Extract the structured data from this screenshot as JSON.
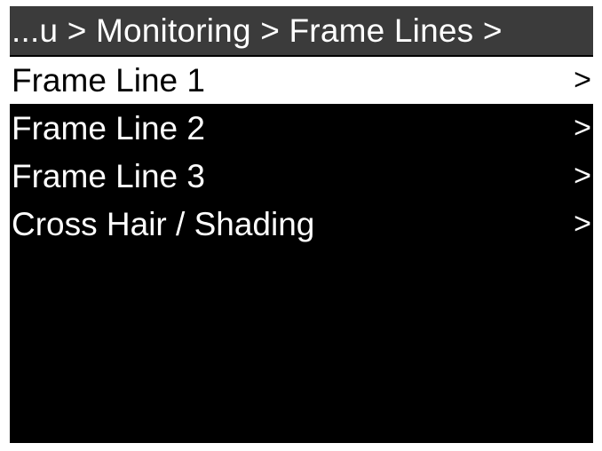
{
  "header": {
    "breadcrumb": "...u > Monitoring > Frame Lines >"
  },
  "menu": {
    "items": [
      {
        "label": "Frame Line 1",
        "chevron": ">",
        "selected": true
      },
      {
        "label": "Frame Line 2",
        "chevron": ">",
        "selected": false
      },
      {
        "label": "Frame Line 3",
        "chevron": ">",
        "selected": false
      },
      {
        "label": "Cross Hair / Shading",
        "chevron": ">",
        "selected": false
      }
    ]
  },
  "colors": {
    "background": "#000000",
    "header_background": "#3b3b3b",
    "selected_background": "#ffffff",
    "text": "#ffffff",
    "selected_text": "#000000"
  },
  "icons": {
    "item_chevron": "chevron-right-icon"
  }
}
